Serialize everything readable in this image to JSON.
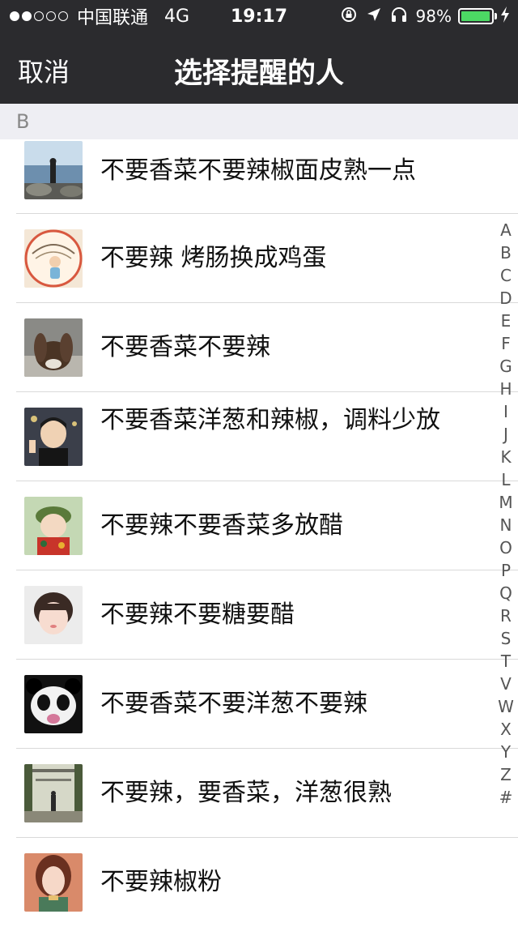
{
  "status_bar": {
    "signal_dots": [
      true,
      true,
      false,
      false,
      false
    ],
    "carrier": "中国联通",
    "network": "4G",
    "time": "19:17",
    "icons": [
      "rotation-lock-icon",
      "location-arrow-icon",
      "headphones-icon"
    ],
    "battery_percent": "98%",
    "battery_level": 0.98,
    "battery_color": "#4cd964"
  },
  "nav": {
    "cancel_label": "取消",
    "title": "选择提醒的人"
  },
  "section": {
    "letter": "B"
  },
  "contacts": [
    {
      "name": "不要香菜不要辣椒面皮熟一点",
      "avatar": "seaside-photo"
    },
    {
      "name": "不要辣 烤肠换成鸡蛋",
      "avatar": "child-illustration"
    },
    {
      "name": "不要香菜不要辣",
      "avatar": "rabbit-photo"
    },
    {
      "name": "不要香菜洋葱和辣椒，调料少放",
      "avatar": "person-peace-sign"
    },
    {
      "name": "不要辣不要香菜多放醋",
      "avatar": "baby-photo"
    },
    {
      "name": "不要辣不要糖要醋",
      "avatar": "girl-photo"
    },
    {
      "name": "不要香菜不要洋葱不要辣",
      "avatar": "panda-meme"
    },
    {
      "name": "不要辣，要香菜，洋葱很熟",
      "avatar": "garden-corridor"
    },
    {
      "name": "不要辣椒粉",
      "avatar": "anime-girl"
    }
  ],
  "index": [
    "A",
    "B",
    "C",
    "D",
    "E",
    "F",
    "G",
    "H",
    "I",
    "J",
    "K",
    "L",
    "M",
    "N",
    "O",
    "P",
    "Q",
    "R",
    "S",
    "T",
    "V",
    "W",
    "X",
    "Y",
    "Z",
    "#"
  ]
}
